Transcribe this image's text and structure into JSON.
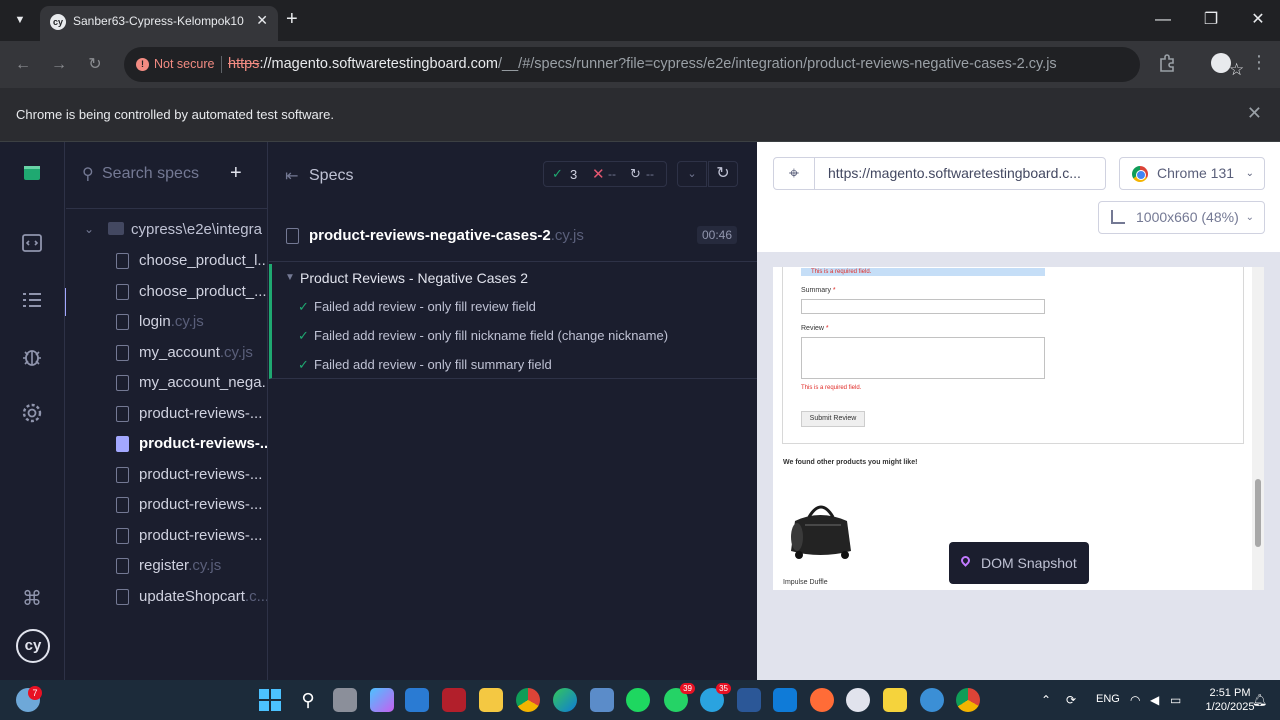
{
  "browser": {
    "tab_title": "Sanber63-Cypress-Kelompok10",
    "not_secure": "Not secure",
    "url_scheme": "https",
    "url_host": "://magento.softwaretestingboard.com",
    "url_path": "/__/#/specs/runner?file=cypress/e2e/integration/product-reviews-negative-cases-2.cy.js",
    "infobar": "Chrome is being controlled by automated test software."
  },
  "specs_list": {
    "search_placeholder": "Search specs",
    "folder": "cypress\\e2e\\integra",
    "items": [
      {
        "name": "choose_product_l...",
        "ext": ""
      },
      {
        "name": "choose_product_...",
        "ext": ""
      },
      {
        "name": "login",
        "ext": ".cy.js"
      },
      {
        "name": "my_account",
        "ext": ".cy.js"
      },
      {
        "name": "my_account_nega...",
        "ext": ""
      },
      {
        "name": "product-reviews-...",
        "ext": ""
      },
      {
        "name": "product-reviews-...",
        "ext": ""
      },
      {
        "name": "product-reviews-...",
        "ext": ""
      },
      {
        "name": "product-reviews-...",
        "ext": ""
      },
      {
        "name": "product-reviews-...",
        "ext": ""
      },
      {
        "name": "register",
        "ext": ".cy.js"
      },
      {
        "name": "updateShopcart",
        "ext": ".c..."
      }
    ],
    "active_index": 6
  },
  "reporter": {
    "specs_label": "Specs",
    "passed": "3",
    "failed": "--",
    "pending": "--",
    "spec_name": "product-reviews-negative-cases-2",
    "spec_ext": ".cy.js",
    "duration": "00:46",
    "suite": "Product Reviews - Negative Cases 2",
    "tests": [
      "Failed add review - only fill review field",
      "Failed add review - only fill nickname field (change nickname)",
      "Failed add review - only fill summary field"
    ]
  },
  "aut": {
    "url": "https://magento.softwaretestingboard.c...",
    "browser": "Chrome 131",
    "viewport": "1000x660 (48%)",
    "dom_snapshot": "DOM Snapshot",
    "page": {
      "required_field_msg": "This is a required field.",
      "summary_label": "Summary",
      "review_label": "Review",
      "required_star": "*",
      "submit_label": "Submit Review",
      "related_title": "We found other products you might like!",
      "product_name": "Impulse Duffle"
    }
  },
  "taskbar": {
    "weather_badge": "7",
    "whatsapp_badge": "39",
    "telegram_badge": "35",
    "language": "ENG",
    "time": "2:51 PM",
    "date": "1/20/2025"
  },
  "colors": {
    "pass": "#1fa971",
    "fail": "#e45770",
    "active_spec": "#a3a8ff",
    "sidebar_bg": "#1b1e2e"
  }
}
